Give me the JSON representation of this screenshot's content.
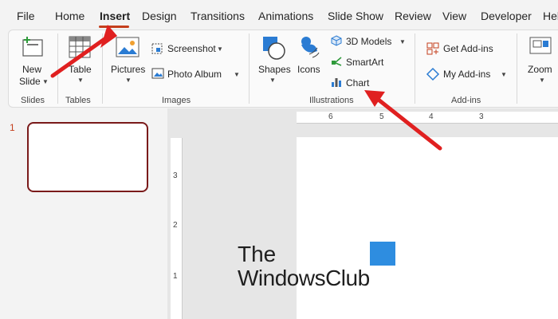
{
  "tabs": [
    "File",
    "Home",
    "Insert",
    "Design",
    "Transitions",
    "Animations",
    "Slide Show",
    "Review",
    "View",
    "Developer",
    "Hel"
  ],
  "active_tab": "Insert",
  "ribbon": {
    "slides": {
      "new_slide_1": "New",
      "new_slide_2": "Slide",
      "group": "Slides"
    },
    "tables": {
      "table": "Table",
      "group": "Tables"
    },
    "images": {
      "pictures": "Pictures",
      "screenshot": "Screenshot",
      "photo_album": "Photo Album",
      "group": "Images"
    },
    "illustrations": {
      "shapes": "Shapes",
      "icons": "Icons",
      "models": "3D Models",
      "smartart": "SmartArt",
      "chart": "Chart",
      "group": "Illustrations"
    },
    "addins": {
      "get": "Get Add-ins",
      "my": "My Add-ins",
      "group": "Add-ins"
    },
    "zoom": {
      "zoom": "Zoom"
    }
  },
  "slide_panel": {
    "number": "1"
  },
  "ruler": {
    "h": [
      "6",
      "5",
      "4",
      "3"
    ],
    "v": [
      "3",
      "2",
      "1"
    ]
  },
  "watermark": {
    "line1": "The",
    "line2": "WindowsClub"
  },
  "colors": {
    "accent": "#c43e1c",
    "arrow": "#e02020",
    "thumb_border": "#7a1a1a"
  }
}
